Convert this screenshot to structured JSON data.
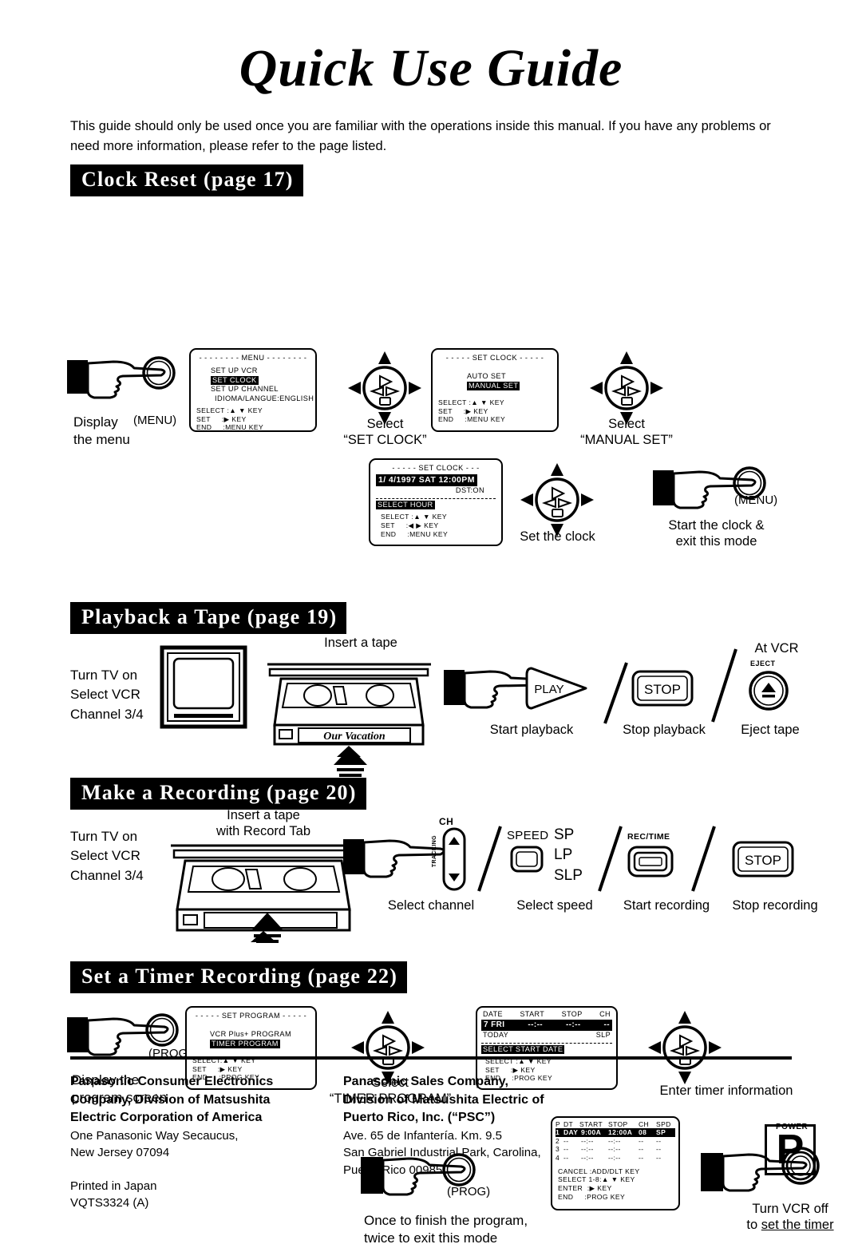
{
  "title": "Quick Use Guide",
  "intro": "This guide should only be used once you are familiar with the operations inside this manual. If you have any problems or need more information, please refer to the page listed.",
  "sections": {
    "clock": {
      "header": "Clock Reset (page 17)",
      "step1_caption_line1": "Display",
      "step1_caption_line2": "the menu",
      "step1_button": "(MENU)",
      "step2_caption_line1": "Select",
      "step2_caption_line2": "“SET CLOCK”",
      "step3_caption_line1": "Select",
      "step3_caption_line2": "“MANUAL SET”",
      "step4_caption": "Set the clock",
      "step5_caption_line1": "Start the clock &",
      "step5_caption_line2": "exit this mode",
      "step5_button": "(MENU)",
      "menu_screen": {
        "title": "MENU",
        "items": [
          "SET UP VCR",
          "SET CLOCK",
          "SET UP CHANNEL",
          "IDIOMA/LANGUE:ENGLISH"
        ],
        "highlighted_index": 1,
        "keys": [
          "SELECT :▲ ▼ KEY",
          "SET     :▶ KEY",
          "END     :MENU KEY"
        ]
      },
      "setclock_screen": {
        "title": "SET CLOCK",
        "items": [
          "AUTO SET",
          "MANUAL SET"
        ],
        "highlighted_index": 1,
        "keys": [
          "SELECT :▲ ▼ KEY",
          "SET     :▶ KEY",
          "END     :MENU KEY"
        ]
      },
      "clockset_screen": {
        "title": "SET CLOCK",
        "datetime": "1/ 4/1997 SAT 12:00PM",
        "dst": "DST:ON",
        "prompt": "SELECT HOUR",
        "keys": [
          "SELECT :▲ ▼ KEY",
          "SET     :◀ ▶ KEY",
          "END     :MENU KEY"
        ]
      }
    },
    "playback": {
      "header": "Playback a Tape (page 19)",
      "tv_lines": [
        "Turn TV on",
        "Select VCR",
        "Channel 3/4"
      ],
      "insert_label": "Insert a tape",
      "tape_label": "Our Vacation",
      "play_button": "PLAY",
      "play_caption": "Start playback",
      "stop_button": "STOP",
      "stop_caption": "Stop playback",
      "at_vcr": "At VCR",
      "eject_label": "EJECT",
      "eject_caption": "Eject tape"
    },
    "recording": {
      "header": "Make a Recording (page 20)",
      "tv_lines": [
        "Turn TV on",
        "Select VCR",
        "Channel 3/4"
      ],
      "insert_label_line1": "Insert a tape",
      "insert_label_line2": "with Record Tab",
      "ch_label": "CH",
      "tracking_label": "TRACKING",
      "channel_caption": "Select channel",
      "speed_label": "SPEED",
      "speeds": [
        "SP",
        "LP",
        "SLP"
      ],
      "speed_caption": "Select speed",
      "rectime_label": "REC/TIME",
      "rec_caption": "Start recording",
      "stop_button": "STOP",
      "stoprec_caption": "Stop recording"
    },
    "timer": {
      "header": "Set a Timer Recording (page 22)",
      "step1_caption_line1": "Display the",
      "step1_caption_line2": "program screen",
      "step1_button": "(PROG)",
      "step2_caption_line1": "Select",
      "step2_caption_line2": "“TIMER PROGRAM”",
      "step3_caption": "Enter timer information",
      "step4_caption_line1": "Once to finish the program,",
      "step4_caption_line2": "twice to exit this mode",
      "step4_button": "(PROG)",
      "step5_caption_line1": "Turn VCR off",
      "step5_caption_line2_pre": "to ",
      "step5_caption_line2_u": "set the timer",
      "power_label": "POWER",
      "setprogram_screen": {
        "title": "SET PROGRAM",
        "items": [
          "VCR Plus+ PROGRAM",
          "TIMER PROGRAM"
        ],
        "highlighted_index": 1,
        "keys": [
          "SELECT:▲ ▼ KEY",
          "SET     :▶ KEY",
          "END     :PROG KEY"
        ]
      },
      "timerentry_screen": {
        "columns": [
          "DATE",
          "START",
          "STOP",
          "CH"
        ],
        "date_value": "7 FRI",
        "start_value": "--:--",
        "stop_value": "--:--",
        "ch_value": "--",
        "today_label": "TODAY",
        "speed_value": "SLP",
        "prompt": "SELECT START DATE",
        "keys": [
          "SELECT :▲ ▼ KEY",
          "SET     :▶ KEY",
          "END     :PROG KEY"
        ]
      },
      "programlist_screen": {
        "columns": [
          "P",
          "DT",
          "START",
          "STOP",
          "CH",
          "SPD"
        ],
        "rows": [
          {
            "p": "1",
            "dt": "DAY",
            "start": "9:00A",
            "stop": "12:00A",
            "ch": "08",
            "spd": "SP"
          },
          {
            "p": "2",
            "dt": "--",
            "start": "--:--",
            "stop": "--:--",
            "ch": "--",
            "spd": "--"
          },
          {
            "p": "3",
            "dt": "--",
            "start": "--:--",
            "stop": "--:--",
            "ch": "--",
            "spd": "--"
          },
          {
            "p": "4",
            "dt": "--",
            "start": "--:--",
            "stop": "--:--",
            "ch": "--",
            "spd": "--"
          }
        ],
        "keys": [
          "CANCEL :ADD/DLT KEY",
          "SELECT 1-8:▲ ▼ KEY",
          "ENTER  :▶ KEY",
          "END     :PROG KEY"
        ]
      }
    }
  },
  "footer": {
    "left_bold": [
      "Panasonic Consumer Electronics",
      "Company, Division of Matsushita",
      "Electric Corporation of America"
    ],
    "left_normal": [
      "One Panasonic Way Secaucus,",
      "New Jersey 07094"
    ],
    "printed": [
      "Printed in Japan",
      "VQTS3324  (A)"
    ],
    "right_bold": [
      "Panasonic Sales Company,",
      "Division of Matsushita Electric of",
      "Puerto Rico, Inc. (“PSC”)"
    ],
    "right_normal": [
      "Ave. 65 de Infantería. Km. 9.5",
      "San Gabriel Industrial Park, Carolina,",
      "Puerto Rico 00985"
    ],
    "logo": "P"
  }
}
